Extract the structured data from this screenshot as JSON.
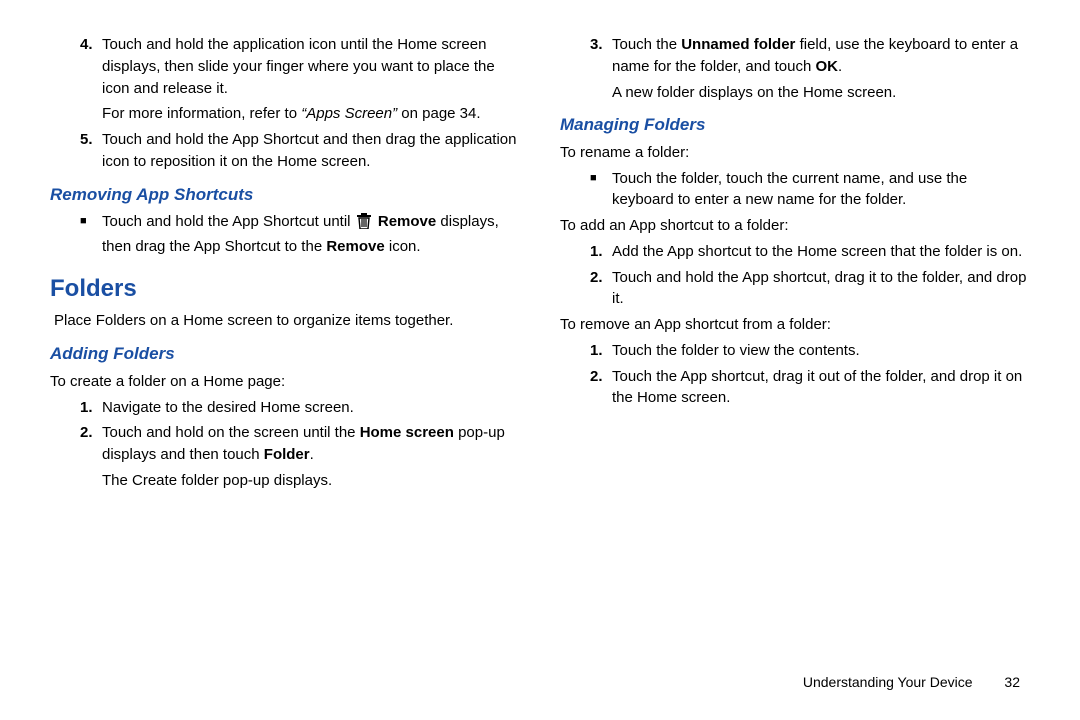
{
  "left": {
    "step4_a": "Touch and hold the application icon until the Home screen displays, then slide your finger where you want to place the icon and release it.",
    "ref_prefix": "For more information, refer to ",
    "ref_title": "“Apps Screen”",
    "ref_suffix": " on page 34.",
    "step5": "Touch and hold the App Shortcut and then drag the application icon to reposition it on the Home screen.",
    "h_removing": "Removing App Shortcuts",
    "removing_b1a": "Touch and hold the App Shortcut until ",
    "removing_b1_rem": "Remove",
    "removing_b1b": " displays, then drag the App Shortcut to the ",
    "removing_b1_rem2": "Remove",
    "removing_b1c": " icon.",
    "h_folders": "Folders",
    "folders_intro": "Place Folders on a Home screen to organize items together.",
    "h_adding": "Adding Folders",
    "adding_intro": "To create a folder on a Home page:",
    "adding_s1": "Navigate to the desired Home screen.",
    "adding_s2a": "Touch and hold on the screen until the ",
    "adding_s2_hs": "Home screen",
    "adding_s2b": " pop-up displays and then touch ",
    "adding_s2_folder": "Folder",
    "adding_s2c": ".",
    "adding_s2_tail": "The Create folder pop-up displays.",
    "num4": "4.",
    "num5": "5.",
    "num1": "1.",
    "num2": "2."
  },
  "right": {
    "num3": "3.",
    "step3a": "Touch the ",
    "step3_unf": "Unnamed folder",
    "step3b": " field, use the keyboard to enter a name for the folder, and touch ",
    "step3_ok": "OK",
    "step3c": ".",
    "step3_tail": "A new folder displays on the Home screen.",
    "h_managing": "Managing Folders",
    "rename_intro": "To rename a folder:",
    "rename_b1": "Touch the folder, touch the current name, and use the keyboard to enter a new name for the folder.",
    "add_intro": "To add an App shortcut to a folder:",
    "add_s1": "Add the App shortcut to the Home screen that the folder is on.",
    "add_s2": "Touch and hold the App shortcut, drag it to the folder, and drop it.",
    "remove_intro": "To remove an App shortcut from a folder:",
    "remove_s1": "Touch the folder to view the contents.",
    "remove_s2": "Touch the App shortcut, drag it out of the folder, and drop it on the Home screen.",
    "num1": "1.",
    "num2": "2."
  },
  "footer": {
    "section": "Understanding Your Device",
    "page": "32"
  }
}
